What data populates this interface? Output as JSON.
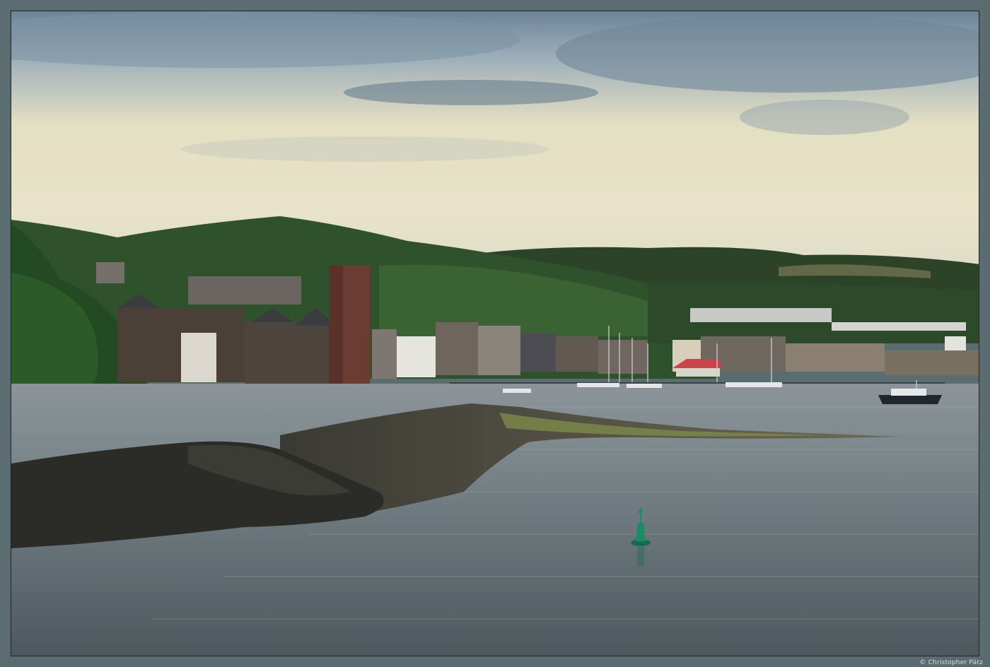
{
  "photo": {
    "credit": "© Christopher Pätz",
    "palette": {
      "frame": "#5b6c70",
      "sky_top": "#6d8497",
      "sky_light": "#e7e3c8",
      "hills": "#2f4a2c",
      "water": "#6f7c82",
      "buoy": "#1e7a60"
    }
  }
}
